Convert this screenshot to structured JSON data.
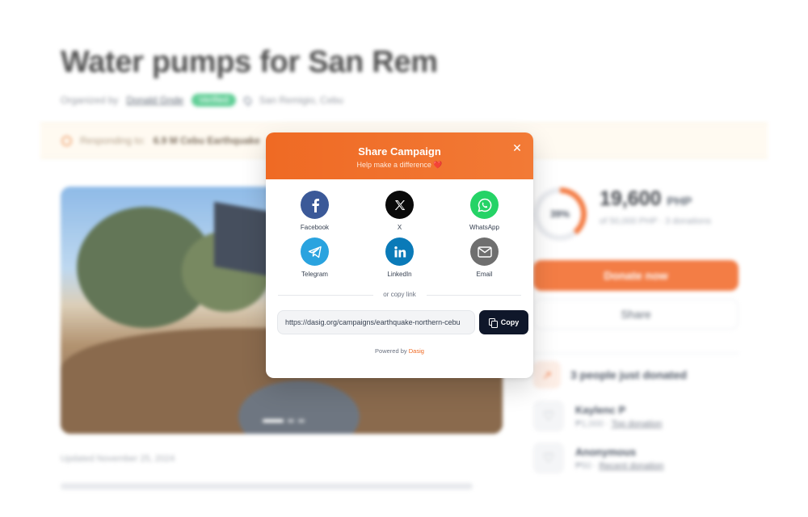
{
  "campaign": {
    "title": "Water pumps for San Rem",
    "organized_by_label": "Organized by",
    "organizer": "Donald Gnde",
    "verified_label": "Verified",
    "location": "San Remigio, Cebu"
  },
  "responding": {
    "label": "Responding to:",
    "event": "6.9 M Cebu Earthquake"
  },
  "photo": {
    "slides": 3,
    "active_slide": 1
  },
  "updated": "Updated November 25, 2024",
  "stats": {
    "percent": 39,
    "percent_label": "39%",
    "raised": "19,600",
    "currency": "PHP",
    "goal_text": "of 50,000 PHP · 3 donations",
    "donate_label": "Donate now",
    "share_label": "Share"
  },
  "recent": {
    "headline": "3 people just donated",
    "donors": [
      {
        "name": "Kaylenc P",
        "amount": "₱1,000",
        "tag": "Top donation"
      },
      {
        "name": "Anonymous",
        "amount": "₱50",
        "tag": "Recent donation"
      }
    ]
  },
  "modal": {
    "title": "Share Campaign",
    "subtitle": "Help make a difference ❤️",
    "options": [
      {
        "label": "Facebook",
        "icon": "facebook-icon",
        "color": "#3b5998"
      },
      {
        "label": "X",
        "icon": "x-icon",
        "color": "#0a0a0a"
      },
      {
        "label": "WhatsApp",
        "icon": "whatsapp-icon",
        "color": "#25d366"
      },
      {
        "label": "Telegram",
        "icon": "telegram-icon",
        "color": "#2aa3df"
      },
      {
        "label": "LinkedIn",
        "icon": "linkedin-icon",
        "color": "#0a7ab8"
      },
      {
        "label": "Email",
        "icon": "email-icon",
        "color": "#6f6f6f"
      }
    ],
    "copy_divider": "or copy link",
    "url": "https://dasig.org/campaigns/earthquake-northern-cebu",
    "copy_label": "Copy",
    "powered_by": "Powered by",
    "brand": "Dasig"
  },
  "colors": {
    "accent": "#ef6a24",
    "dark_button": "#0f172a",
    "verified": "#4ec98a"
  }
}
